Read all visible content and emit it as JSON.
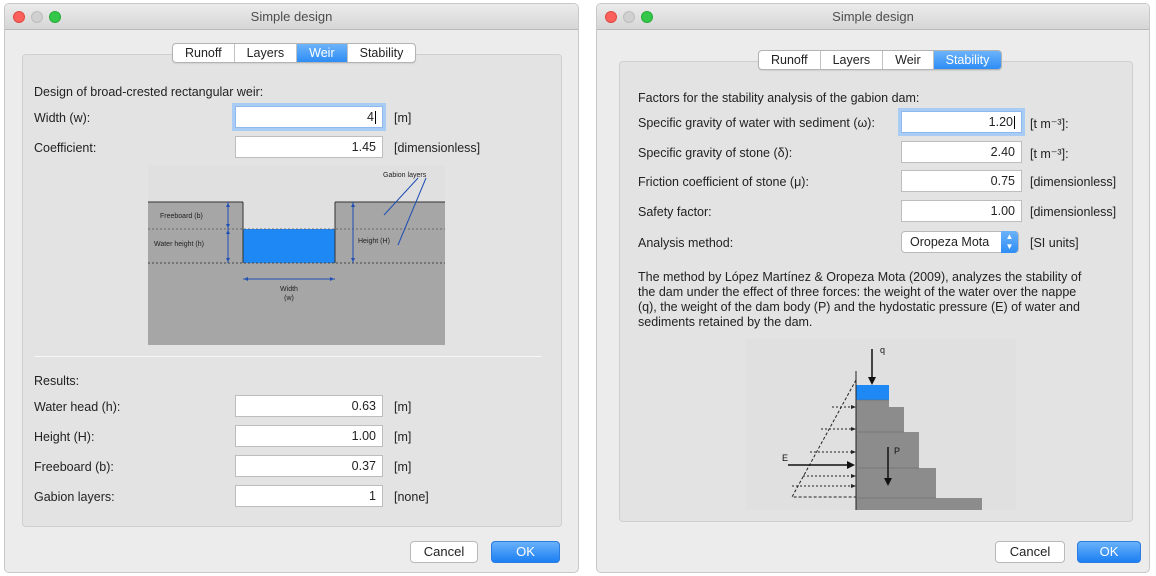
{
  "left": {
    "title": "Simple design",
    "tabs": [
      {
        "label": "Runoff"
      },
      {
        "label": "Layers"
      },
      {
        "label": "Weir"
      },
      {
        "label": "Stability"
      }
    ],
    "section_title": "Design of broad-crested rectangular weir:",
    "inputs": {
      "width_label": "Width (w):",
      "width_value": "4",
      "width_unit": "[m]",
      "coef_label": "Coefficient:",
      "coef_value": "1.45",
      "coef_unit": "[dimensionless]"
    },
    "diagram": {
      "gabion_layers": "Gabion layers",
      "freeboard": "Freeboard (b)",
      "water_height": "Water height (h)",
      "height": "Height (H)",
      "width": "Width",
      "width_sub": "(w)"
    },
    "results": {
      "title": "Results:",
      "rows": [
        {
          "label": "Water head (h):",
          "value": "0.63",
          "unit": "[m]"
        },
        {
          "label": "Height (H):",
          "value": "1.00",
          "unit": "[m]"
        },
        {
          "label": "Freeboard (b):",
          "value": "0.37",
          "unit": "[m]"
        },
        {
          "label": "Gabion layers:",
          "value": "1",
          "unit": "[none]"
        }
      ]
    },
    "buttons": {
      "cancel": "Cancel",
      "ok": "OK"
    }
  },
  "right": {
    "title": "Simple design",
    "tabs": [
      {
        "label": "Runoff"
      },
      {
        "label": "Layers"
      },
      {
        "label": "Weir"
      },
      {
        "label": "Stability"
      }
    ],
    "section_title": "Factors for the stability analysis of the gabion dam:",
    "rows": [
      {
        "label": "Specific gravity of water with sediment (ω):",
        "value": "1.20",
        "unit": "[t m⁻³]:"
      },
      {
        "label": "Specific gravity of stone (δ):",
        "value": "2.40",
        "unit": "[t m⁻³]:"
      },
      {
        "label": "Friction coefficient of stone (μ):",
        "value": "0.75",
        "unit": "[dimensionless]"
      },
      {
        "label": "Safety factor:",
        "value": "1.00",
        "unit": "[dimensionless]"
      }
    ],
    "method": {
      "label": "Analysis method:",
      "selected": "Oropeza Mota",
      "unit": "[SI units]"
    },
    "description": [
      "The method by López Martínez & Oropeza Mota (2009), analyzes the stability of",
      "the dam under the effect of three forces: the weight of the water over the nappe",
      "(q), the weight of the dam body (P) and the hydostatic pressure (E) of water and",
      "sediments retained by the dam."
    ],
    "diagram": {
      "q": "q",
      "p": "P",
      "e": "E"
    },
    "buttons": {
      "cancel": "Cancel",
      "ok": "OK"
    }
  },
  "colors": {
    "accent": "#2e8df5",
    "water": "#1e88f5",
    "gabion": "#8c8c8c"
  }
}
